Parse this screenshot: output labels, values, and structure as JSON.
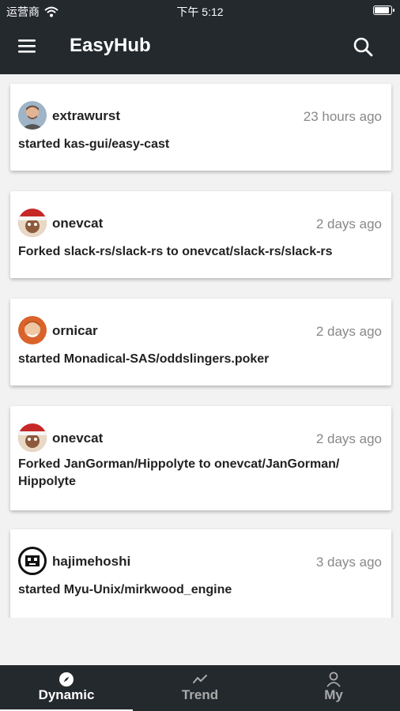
{
  "status_bar": {
    "carrier": "运营商",
    "time": "下午 5:12",
    "battery_level": 1.0
  },
  "header": {
    "title": "EasyHub"
  },
  "feed": [
    {
      "user": "extrawurst",
      "time": "23 hours ago",
      "action": "started kas-gui/easy-cast"
    },
    {
      "user": "onevcat",
      "time": "2 days ago",
      "action": "Forked slack-rs/slack-rs to onevcat/slack-rs/slack-rs"
    },
    {
      "user": "ornicar",
      "time": "2 days ago",
      "action": "started Monadical-SAS/oddslingers.poker"
    },
    {
      "user": "onevcat",
      "time": "2 days ago",
      "action": "Forked JanGorman/Hippolyte to onevcat/JanGorman/ Hippolyte"
    },
    {
      "user": "hajimehoshi",
      "time": "3 days ago",
      "action": "started Myu-Unix/mirkwood_engine"
    }
  ],
  "tabs": [
    {
      "label": "Dynamic",
      "icon": "compass-icon",
      "active": true
    },
    {
      "label": "Trend",
      "icon": "trend-icon",
      "active": false
    },
    {
      "label": "My",
      "icon": "person-icon",
      "active": false
    }
  ],
  "colors": {
    "header_bg": "#24292e",
    "tabbar_bg": "#24292e",
    "page_bg": "#f2f2f2",
    "muted_text": "#888888"
  }
}
